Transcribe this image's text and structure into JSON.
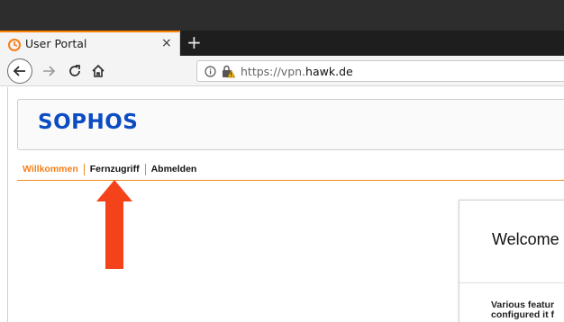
{
  "browser": {
    "tab": {
      "title": "User Portal",
      "close": "×"
    },
    "new_tab": "+",
    "address": {
      "prefix": "https://vpn.",
      "domain": "hawk.de"
    },
    "accent_color": "#ff7f00"
  },
  "portal": {
    "logo": "SOPHOS",
    "logo_color": "#0b4cc2",
    "menu": [
      {
        "label": "Willkommen",
        "active": true
      },
      {
        "label": "Fernzugriff",
        "active": false
      },
      {
        "label": "Abmelden",
        "active": false
      }
    ],
    "menu_accent": "#f57f17",
    "welcome": {
      "title": "Welcome",
      "body_lines": [
        "Various featur",
        "configured it f"
      ]
    }
  },
  "annotation": {
    "icon": "red-arrow-up-icon",
    "color": "#f4421b"
  }
}
